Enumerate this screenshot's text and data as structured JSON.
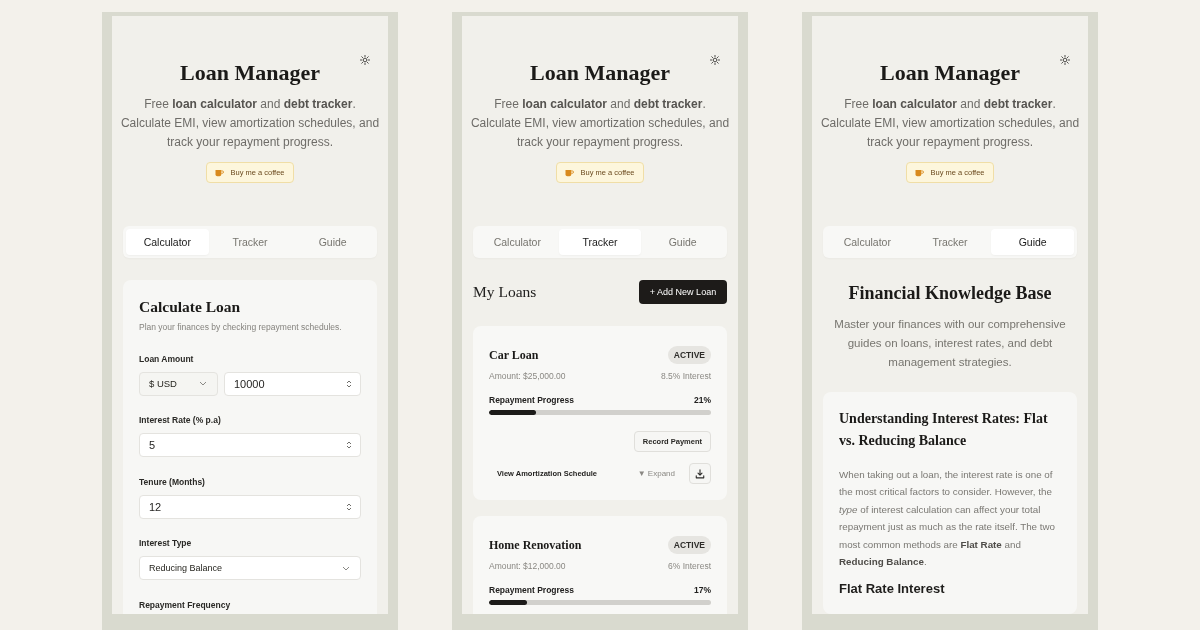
{
  "screens": [
    {
      "kind": "calculator",
      "header": {
        "title": "Loan Manager",
        "subtitle": "Free **loan calculator** and **debt tracker**. Calculate EMI, view amortization schedules, and track your repayment progress.",
        "coffee_button": "Buy me a coffee"
      },
      "tabs": [
        {
          "label": "Calculator",
          "selected": true
        },
        {
          "label": "Tracker",
          "selected": false
        },
        {
          "label": "Guide",
          "selected": false
        }
      ],
      "form": {
        "title": "Calculate Loan",
        "description": "Plan your finances by checking repayment schedules.",
        "fields": [
          {
            "kind": "amount",
            "label": "Loan Amount",
            "currency": "$ USD",
            "value": "10000"
          },
          {
            "kind": "number",
            "label": "Interest Rate (% p.a)",
            "value": "5"
          },
          {
            "kind": "number",
            "label": "Tenure (Months)",
            "value": "12"
          },
          {
            "kind": "select",
            "label": "Interest Type",
            "value": "Reducing Balance"
          },
          {
            "kind": "label",
            "label": "Repayment Frequency"
          }
        ]
      }
    },
    {
      "kind": "tracker",
      "header": {
        "title": "Loan Manager",
        "subtitle": "Free **loan calculator** and **debt tracker**. Calculate EMI, view amortization schedules, and track your repayment progress.",
        "coffee_button": "Buy me a coffee"
      },
      "tabs": [
        {
          "label": "Calculator",
          "selected": false
        },
        {
          "label": "Tracker",
          "selected": true
        },
        {
          "label": "Guide",
          "selected": false
        }
      ],
      "loans": {
        "title": "My Loans",
        "add_button": "+ Add New Loan",
        "items": [
          {
            "name": "Car Loan",
            "status": "ACTIVE",
            "amount": "Amount: $25,000.00",
            "interest": "8.5% Interest",
            "progress_label": "Repayment Progress",
            "percent": "21%",
            "level": 0.21,
            "record_button": "Record Payment",
            "schedule_label": "View Amortization Schedule",
            "expand": "▼ Expand"
          },
          {
            "name": "Home Renovation",
            "status": "ACTIVE",
            "amount": "Amount: $12,000.00",
            "interest": "6% Interest",
            "progress_label": "Repayment Progress",
            "percent": "17%",
            "level": 0.17
          }
        ]
      }
    },
    {
      "kind": "guide",
      "header": {
        "title": "Loan Manager",
        "subtitle": "Free **loan calculator** and **debt tracker**. Calculate EMI, view amortization schedules, and track your repayment progress.",
        "coffee_button": "Buy me a coffee"
      },
      "tabs": [
        {
          "label": "Calculator",
          "selected": false
        },
        {
          "label": "Tracker",
          "selected": false
        },
        {
          "label": "Guide",
          "selected": true
        }
      ],
      "guide": {
        "title": "Financial Knowledge Base",
        "intro": "Master your finances with our comprehensive guides on loans, interest rates, and debt management strategies.",
        "article": {
          "title": "Understanding Interest Rates: Flat vs. Reducing Balance",
          "body": "When taking out a loan, the interest rate is one of the most critical factors to consider. However, the *type* of interest calculation can affect your total repayment just as much as the rate itself. The two most common methods are **Flat Rate** and **Reducing Balance**.",
          "subheading": "Flat Rate Interest"
        }
      }
    }
  ]
}
